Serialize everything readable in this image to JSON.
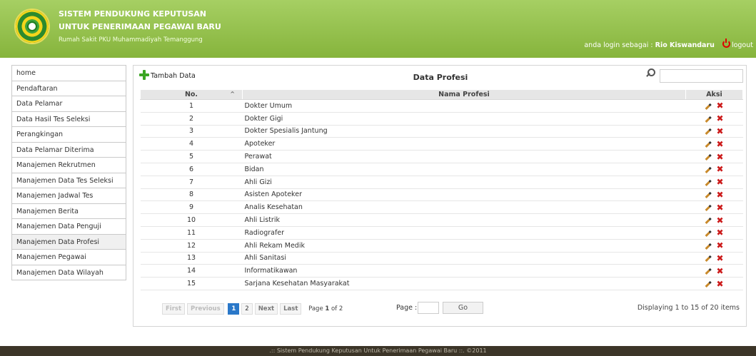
{
  "header": {
    "title_line1": "SISTEM PENDUKUNG KEPUTUSAN",
    "title_line2": "UNTUK PENERIMAAN PEGAWAI BARU",
    "subtitle": "Rumah Sakit PKU Muhammadiyah Temanggung",
    "login_prefix": "anda login sebagai :",
    "user_name": "Rio Kiswandaru",
    "logout_label": "logout"
  },
  "sidebar": {
    "items": [
      {
        "label": "home"
      },
      {
        "label": "Pendaftaran"
      },
      {
        "label": "Data Pelamar"
      },
      {
        "label": "Data Hasil Tes Seleksi"
      },
      {
        "label": "Perangkingan"
      },
      {
        "label": "Data Pelamar Diterima"
      },
      {
        "label": "Manajemen Rekrutmen"
      },
      {
        "label": "Manajemen Data Tes Seleksi"
      },
      {
        "label": "Manajemen Jadwal Tes"
      },
      {
        "label": "Manajemen Berita"
      },
      {
        "label": "Manajemen Data Penguji"
      },
      {
        "label": "Manajemen Data Profesi"
      },
      {
        "label": "Manajemen Pegawai"
      },
      {
        "label": "Manajemen Data Wilayah"
      }
    ],
    "active_index": 11
  },
  "panel": {
    "add_label": "Tambah Data",
    "title": "Data Profesi",
    "search_value": ""
  },
  "table": {
    "headers": {
      "no": "No.",
      "name": "Nama Profesi",
      "aksi": "Aksi"
    },
    "sort_indicator": "^",
    "rows": [
      {
        "no": "1",
        "name": "Dokter Umum"
      },
      {
        "no": "2",
        "name": "Dokter Gigi"
      },
      {
        "no": "3",
        "name": "Dokter Spesialis Jantung"
      },
      {
        "no": "4",
        "name": "Apoteker"
      },
      {
        "no": "5",
        "name": "Perawat"
      },
      {
        "no": "6",
        "name": "Bidan"
      },
      {
        "no": "7",
        "name": "Ahli Gizi"
      },
      {
        "no": "8",
        "name": "Asisten Apoteker"
      },
      {
        "no": "9",
        "name": "Analis Kesehatan"
      },
      {
        "no": "10",
        "name": "Ahli Listrik"
      },
      {
        "no": "11",
        "name": "Radiografer"
      },
      {
        "no": "12",
        "name": "Ahli Rekam Medik"
      },
      {
        "no": "13",
        "name": "Ahli Sanitasi"
      },
      {
        "no": "14",
        "name": "Informatikawan"
      },
      {
        "no": "15",
        "name": "Sarjana Kesehatan Masyarakat"
      }
    ]
  },
  "pager": {
    "first": "First",
    "previous": "Previous",
    "pages": [
      "1",
      "2"
    ],
    "current_page": "1",
    "next": "Next",
    "last": "Last",
    "page_prefix": "Page",
    "page_current": "1",
    "page_of": "of 2",
    "page_label": "Page :",
    "page_input": "",
    "go_label": "Go",
    "display_info": "Displaying 1 to 15 of 20 items"
  },
  "footer": {
    "text": ".:: Sistem Pendukung Keputusan Untuk Penerimaan Pegawai Baru ::. ©2011"
  },
  "icons": {
    "add": "plus-icon",
    "search": "search-icon",
    "edit": "pencil-icon",
    "delete": "delete-x-icon",
    "logout": "power-icon"
  },
  "colors": {
    "header_green": "#8fbf47",
    "add_green": "#3aa523",
    "current_page_blue": "#2a78c9",
    "delete_red": "#cc1b1b",
    "footer_dark": "#3c3528"
  }
}
